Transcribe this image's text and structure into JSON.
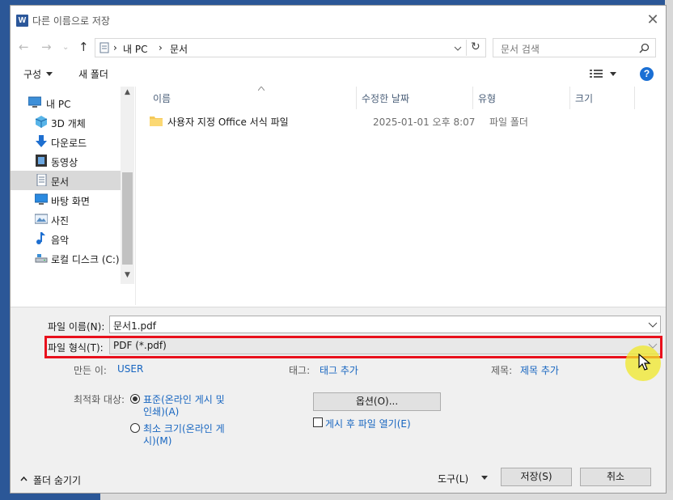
{
  "window": {
    "title": "다른 이름으로 저장"
  },
  "nav": {
    "breadcrumb": [
      "내 PC",
      "문서"
    ],
    "search_placeholder": "문서 검색"
  },
  "toolbar": {
    "organize": "구성",
    "new_folder": "새 폴더"
  },
  "sidebar": {
    "items": [
      {
        "label": "내 PC",
        "icon": "pc-icon"
      },
      {
        "label": "3D 개체",
        "icon": "cube-icon"
      },
      {
        "label": "다운로드",
        "icon": "download-icon"
      },
      {
        "label": "동영상",
        "icon": "video-icon"
      },
      {
        "label": "문서",
        "icon": "document-icon",
        "selected": true
      },
      {
        "label": "바탕 화면",
        "icon": "desktop-icon"
      },
      {
        "label": "사진",
        "icon": "picture-icon"
      },
      {
        "label": "음악",
        "icon": "music-icon"
      },
      {
        "label": "로컬 디스크 (C:)",
        "icon": "drive-icon"
      }
    ]
  },
  "file_list": {
    "columns": [
      "이름",
      "수정한 날짜",
      "유형",
      "크기"
    ],
    "rows": [
      {
        "name": "사용자 지정 Office 서식 파일",
        "modified": "2025-01-01 오후 8:07",
        "type": "파일 폴더",
        "size": ""
      }
    ]
  },
  "form": {
    "filename_label": "파일 이름(N):",
    "filename_value": "문서1.pdf",
    "filetype_label": "파일 형식(T):",
    "filetype_value": "PDF (*.pdf)",
    "author_label": "만든 이:",
    "author_value": "USER",
    "tags_label": "태그:",
    "tags_value": "태그 추가",
    "title_label": "제목:",
    "title_value": "제목 추가",
    "optimize_label": "최적화 대상:",
    "opt_standard_1": "표준(온라인 게시 및",
    "opt_standard_2": "인쇄)(A)",
    "opt_min_1": "최소 크기(온라인 게",
    "opt_min_2": "시)(M)",
    "options_button": "옵션(O)...",
    "open_after": "게시 후 파일 열기(E)"
  },
  "footer": {
    "hide_folders": "폴더 숨기기",
    "tools": "도구(L)",
    "save": "저장(S)",
    "cancel": "취소"
  },
  "colors": {
    "highlight": "#e8101c",
    "link": "#1665c0",
    "cursor_halo": "#f0e828"
  }
}
